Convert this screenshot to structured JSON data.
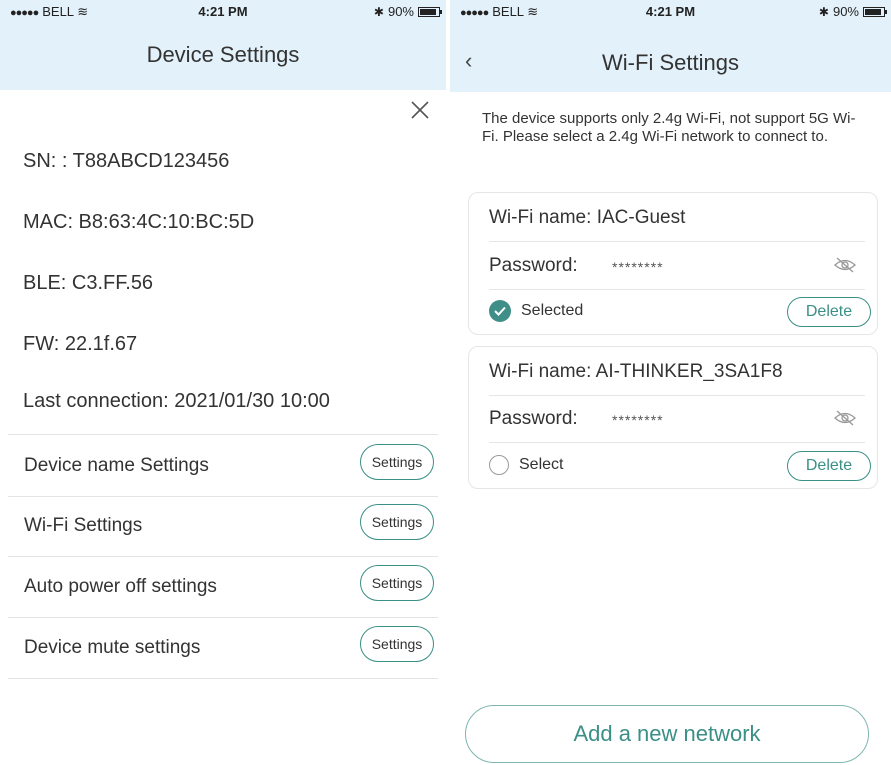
{
  "status_bar": {
    "carrier": "BELL",
    "time": "4:21 PM",
    "battery": "90%",
    "battery_level": 0.9
  },
  "device_settings": {
    "title": "Device Settings",
    "info": {
      "sn": "SN: : T88ABCD123456",
      "mac": "MAC: B8:63:4C:10:BC:5D",
      "ble": "BLE: C3.FF.56",
      "fw": "FW: 22.1f.67",
      "last_connection": "Last connection: 2021/01/30 10:00"
    },
    "rows": [
      {
        "label": "Device name Settings",
        "button": "Settings"
      },
      {
        "label": "Wi-Fi Settings",
        "button": "Settings"
      },
      {
        "label": "Auto power off settings",
        "button": "Settings"
      },
      {
        "label": "Device mute settings",
        "button": "Settings"
      }
    ]
  },
  "wifi_settings": {
    "title": "Wi-Fi Settings",
    "note": "The device supports only 2.4g Wi-Fi, not support 5G Wi-Fi. Please select a 2.4g Wi-Fi network to connect to.",
    "name_label": "Wi-Fi name:",
    "password_label": "Password:",
    "networks": [
      {
        "name": "IAC-Guest",
        "password": "********",
        "select_label": "Selected",
        "selected": true,
        "delete": "Delete"
      },
      {
        "name": "AI-THINKER_3SA1F8",
        "password": "********",
        "select_label": "Select",
        "selected": false,
        "delete": "Delete"
      }
    ],
    "add_button": "Add a new network"
  },
  "colors": {
    "header_bg": "#e3f1fa",
    "accent": "#3a8f86"
  }
}
